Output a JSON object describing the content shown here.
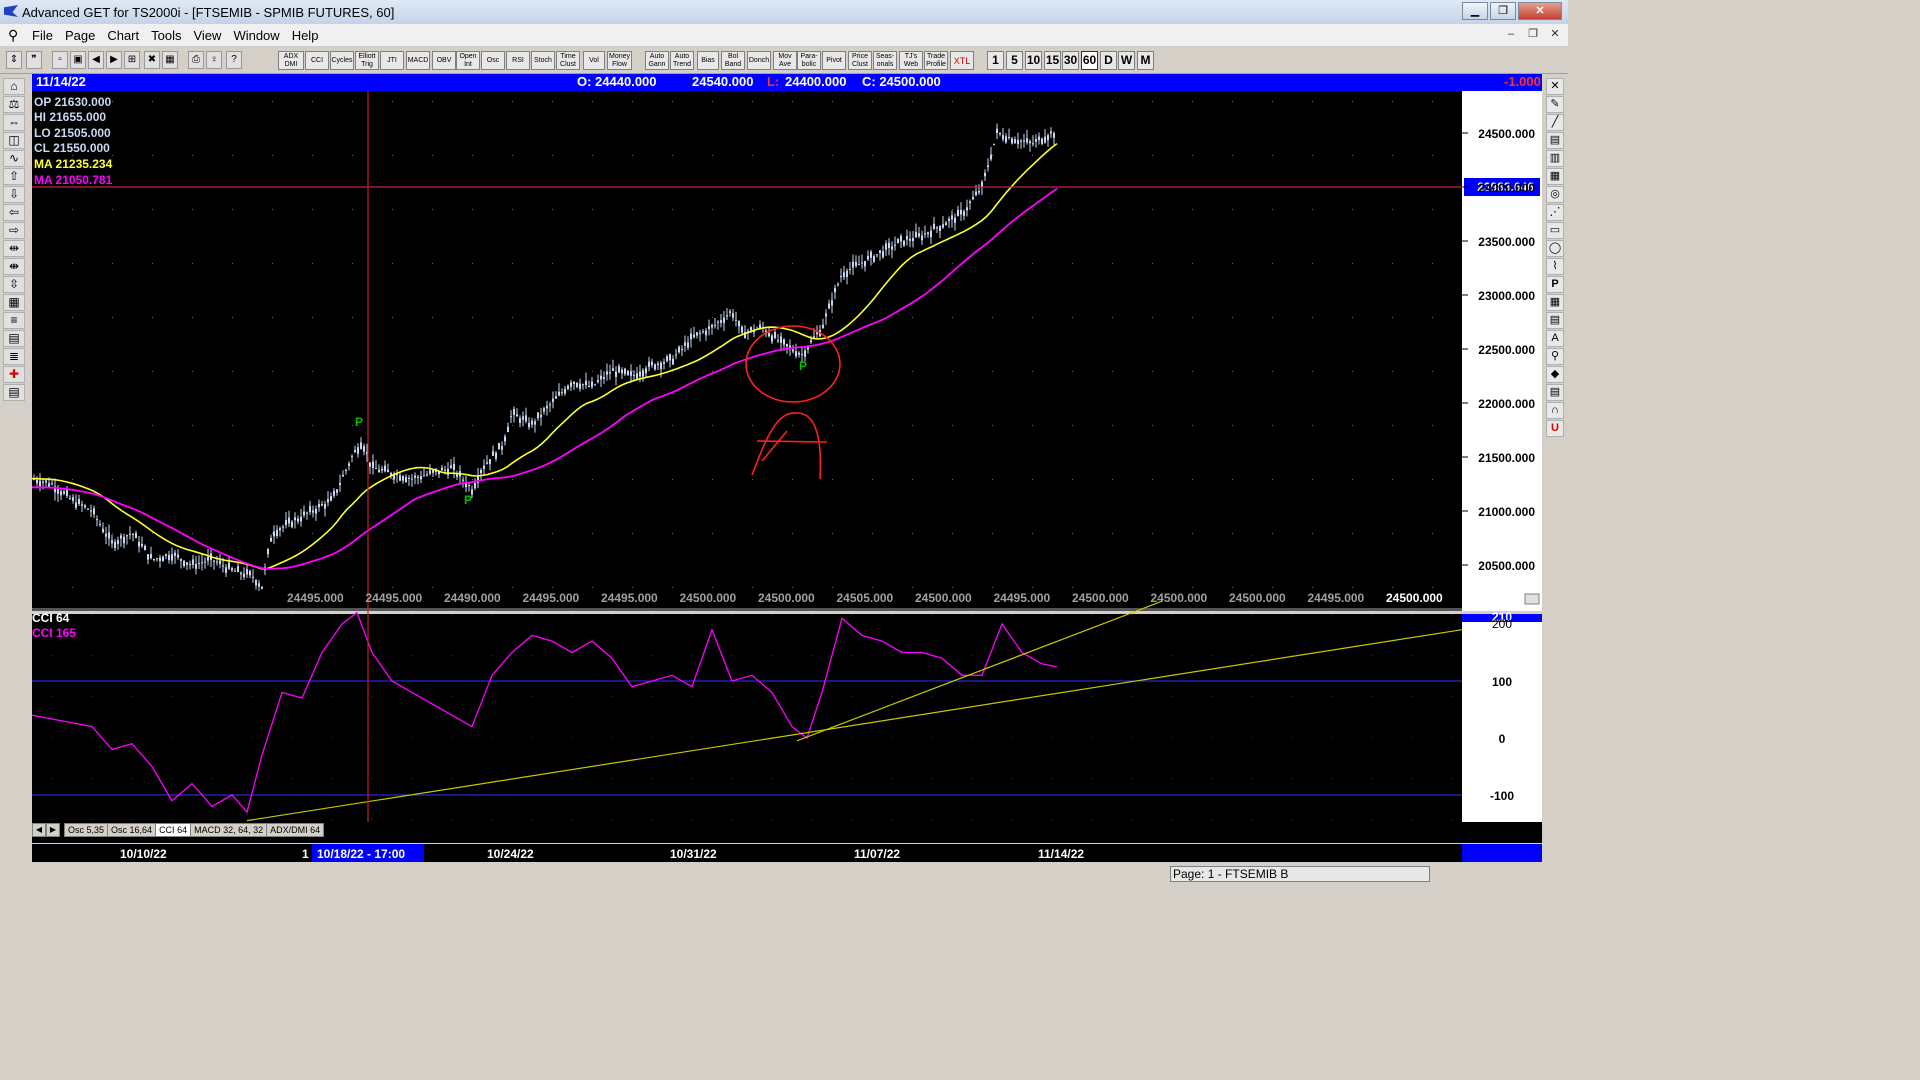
{
  "window": {
    "title": "Advanced GET for TS2000i - [FTSEMIB - SPMIB FUTURES, 60]"
  },
  "menu": [
    "File",
    "Page",
    "Chart",
    "Tools",
    "View",
    "Window",
    "Help"
  ],
  "toolbar": {
    "indicators": [
      "ADX DMI",
      "CCI",
      "Cycles",
      "Elliott Trig",
      "JTI",
      "MACD",
      "OBV",
      "Open Int",
      "Osc",
      "RSI",
      "Stoch",
      "Time Clust",
      "Vol",
      "Money Flow",
      "Auto Gann",
      "Auto Trend",
      "Bias",
      "Bol Band",
      "Donch",
      "Mov Ave",
      "Para-bolic",
      "Pivot",
      "Price Clust",
      "Seas-onals",
      "TJ's Web",
      "Trade Profile",
      "XTL"
    ],
    "periods": [
      "1",
      "5",
      "10",
      "15",
      "30",
      "60",
      "D",
      "W",
      "M"
    ],
    "active_period": "60"
  },
  "infobar": {
    "date": "11/14/22",
    "open": "O: 24440.000",
    "high": "24540.000",
    "low_label": "L:",
    "low": "24400.000",
    "close": "C: 24500.000",
    "change": "-1.000"
  },
  "legend": {
    "op": "OP 21630.000",
    "hi": "HI 21655.000",
    "lo": "LO 21505.000",
    "cl": "CL 21550.000",
    "ma1": "MA 21235.234",
    "ma2": "MA 21050.781"
  },
  "price_axis": [
    "24500.000",
    "24000.000",
    "23500.000",
    "23000.000",
    "22500.000",
    "22000.000",
    "21500.000",
    "21000.000",
    "20500.000"
  ],
  "price_cursor_label": "23983.646",
  "bottom_price_labels": [
    "24495.000",
    "24495.000",
    "24490.000",
    "24495.000",
    "24495.000",
    "24500.000",
    "24500.000",
    "24505.000",
    "24500.000",
    "24495.000",
    "24500.000",
    "24500.000",
    "24500.000",
    "24495.000",
    "24500.000"
  ],
  "cci_legend": {
    "title": "CCI 64",
    "value": "CCI 165"
  },
  "cci_axis": [
    "100",
    "0",
    "-100"
  ],
  "cci_top_label": "210",
  "cci_partial": "200",
  "pivot_label": "P",
  "date_axis": [
    "10/10/22",
    "10/24/22",
    "10/31/22",
    "11/07/22",
    "11/14/22"
  ],
  "date_cursor": "10/18/22 - 17:00",
  "date_cursor_prefix": "1",
  "tabs": [
    "Osc 5,35",
    "Osc 16,64",
    "CCI 64",
    "MACD 32, 64, 32",
    "ADX/DMI 64"
  ],
  "active_tab": "CCI 64",
  "status": {
    "page": "Page: 1 - FTSEMIB B"
  },
  "colors": {
    "chart_bg": "#000000",
    "infobar": "#0000ff",
    "ma_yellow": "#ffff33",
    "ma_magenta": "#ff00ff",
    "candles": "#c8d8f0",
    "pivot": "#00c000",
    "annotation": "#ff2020"
  }
}
